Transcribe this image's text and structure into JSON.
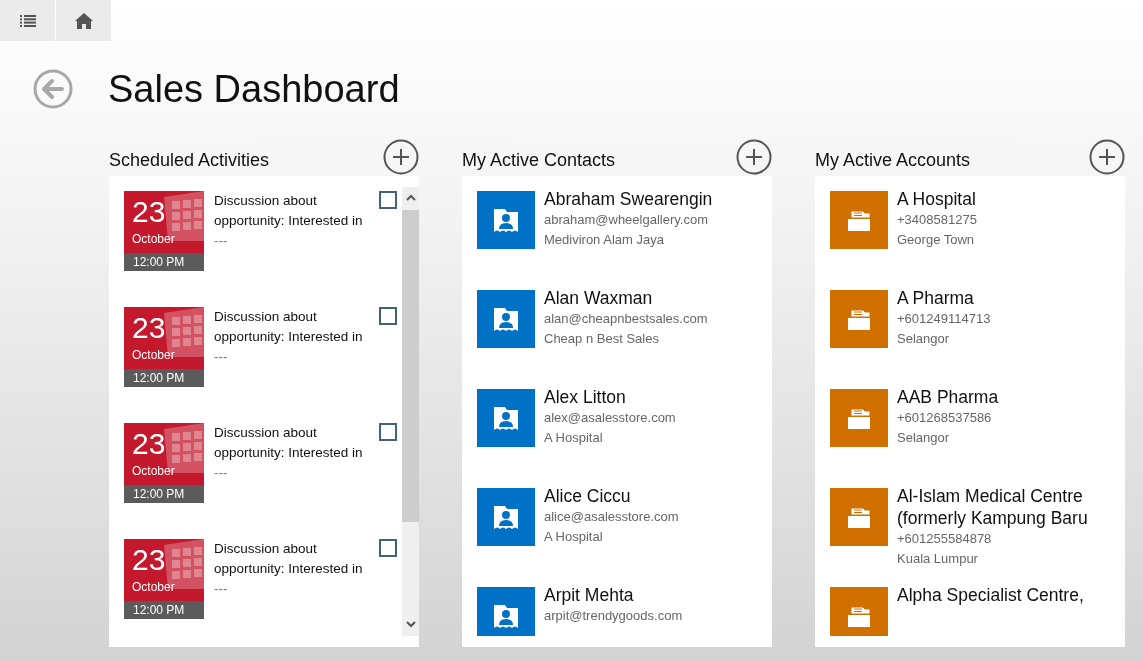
{
  "page": {
    "title": "Sales Dashboard"
  },
  "activities": {
    "title": "Scheduled Activities",
    "items": [
      {
        "day": "23",
        "month": "October",
        "time": "12:00 PM",
        "subject": "Discussion about opportunity: Interested in",
        "detail": "---",
        "checked": false
      },
      {
        "day": "23",
        "month": "October",
        "time": "12:00 PM",
        "subject": "Discussion about opportunity: Interested in",
        "detail": "---",
        "checked": false
      },
      {
        "day": "23",
        "month": "October",
        "time": "12:00 PM",
        "subject": "Discussion about opportunity: Interested in",
        "detail": "---",
        "checked": false
      },
      {
        "day": "23",
        "month": "October",
        "time": "12:00 PM",
        "subject": "Discussion about opportunity: Interested in",
        "detail": "---",
        "checked": false
      }
    ]
  },
  "contacts": {
    "title": "My Active Contacts",
    "items": [
      {
        "name": "Abraham Swearengin",
        "email": "abraham@wheelgallery.com",
        "company": "Mediviron Alam Jaya"
      },
      {
        "name": "Alan Waxman",
        "email": "alan@cheapnbestsales.com",
        "company": "Cheap n Best Sales"
      },
      {
        "name": "Alex Litton",
        "email": "alex@asalesstore.com",
        "company": "A Hospital"
      },
      {
        "name": "Alice Ciccu",
        "email": "alice@asalesstore.com",
        "company": "A Hospital"
      },
      {
        "name": "Arpit Mehta",
        "email": "arpit@trendygoods.com"
      }
    ]
  },
  "accounts": {
    "title": "My Active Accounts",
    "items": [
      {
        "name": "A Hospital",
        "phone": "+3408581275",
        "city": "George Town"
      },
      {
        "name": "A Pharma",
        "phone": "+601249114713",
        "city": "Selangor"
      },
      {
        "name": "AAB Pharma",
        "phone": "+601268537586",
        "city": "Selangor"
      },
      {
        "name": "Al-Islam Medical Centre (formerly Kampung Baru",
        "phone": "+601255584878",
        "city": "Kuala Lumpur"
      },
      {
        "name": "Alpha Specialist Centre,"
      }
    ]
  }
}
